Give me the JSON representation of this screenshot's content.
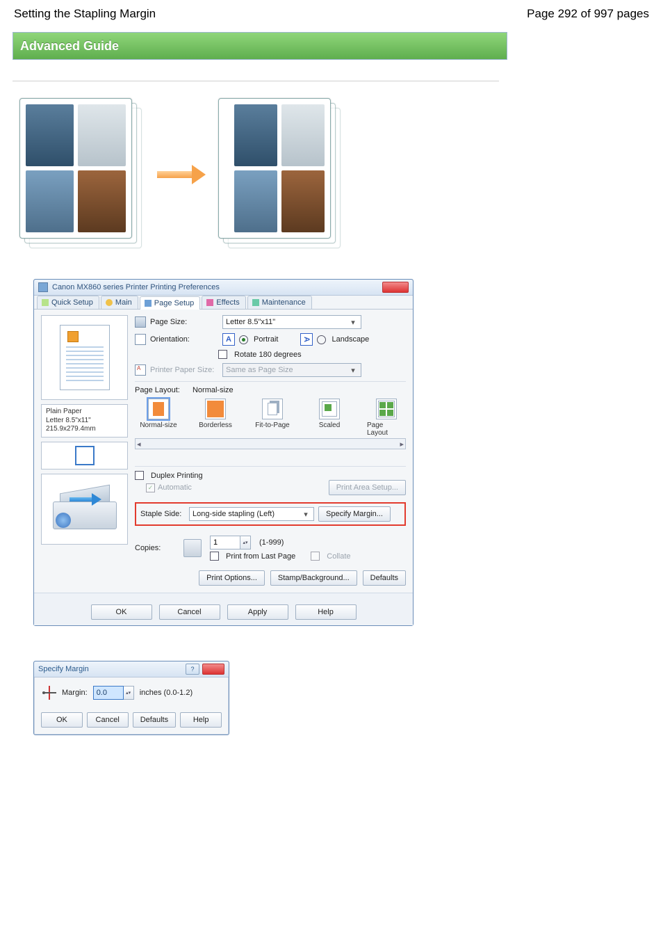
{
  "header": {
    "title": "Setting the Stapling Margin",
    "pager": "Page 292 of 997 pages"
  },
  "guide": "Advanced Guide",
  "dialog": {
    "title": "Canon MX860 series Printer Printing Preferences",
    "tabs": [
      "Quick Setup",
      "Main",
      "Page Setup",
      "Effects",
      "Maintenance"
    ],
    "active_tab": "Page Setup",
    "page_size_label": "Page Size:",
    "page_size_value": "Letter 8.5\"x11\"",
    "orientation_label": "Orientation:",
    "portrait": "Portrait",
    "landscape": "Landscape",
    "rotate_label": "Rotate 180 degrees",
    "printer_paper_label": "Printer Paper Size:",
    "printer_paper_value": "Same as Page Size",
    "layout_label": "Page Layout:",
    "layout_value": "Normal-size",
    "layouts": [
      "Normal-size",
      "Borderless",
      "Fit-to-Page",
      "Scaled",
      "Page Layout"
    ],
    "media_line1": "Plain Paper",
    "media_line2": "Letter 8.5\"x11\" 215.9x279.4mm",
    "duplex_label": "Duplex Printing",
    "automatic_label": "Automatic",
    "print_area_btn": "Print Area Setup...",
    "staple_label": "Staple Side:",
    "staple_value": "Long-side stapling (Left)",
    "specify_margin_btn": "Specify Margin...",
    "copies_label": "Copies:",
    "copies_value": "1",
    "copies_range": "(1-999)",
    "print_last_label": "Print from Last Page",
    "collate_label": "Collate",
    "print_options_btn": "Print Options...",
    "stamp_btn": "Stamp/Background...",
    "defaults_btn": "Defaults",
    "ok": "OK",
    "cancel": "Cancel",
    "apply": "Apply",
    "help": "Help"
  },
  "margin_dialog": {
    "title": "Specify Margin",
    "label": "Margin:",
    "value": "0.0",
    "unit": "inches (0.0-1.2)",
    "ok": "OK",
    "cancel": "Cancel",
    "defaults": "Defaults",
    "help": "Help"
  }
}
